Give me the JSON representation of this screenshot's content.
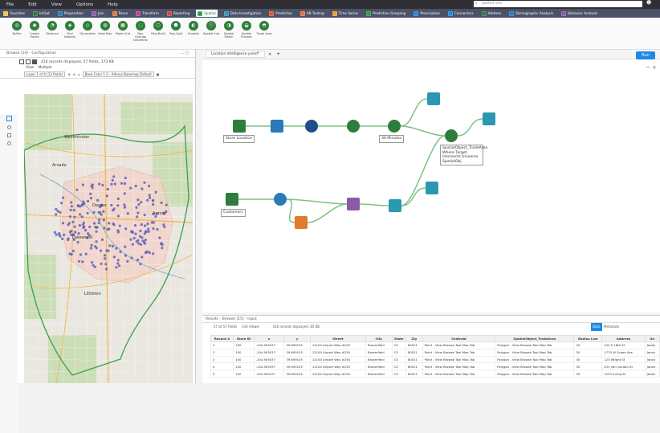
{
  "menu": {
    "items": [
      "File",
      "Edit",
      "View",
      "Options",
      "Help"
    ],
    "search_placeholder": "spatial info"
  },
  "categories": [
    {
      "label": "Favorites",
      "color": "#f4c542"
    },
    {
      "label": "In/Out",
      "color": "#2f7d3c"
    },
    {
      "label": "Preparation",
      "color": "#2a7ab9"
    },
    {
      "label": "Join",
      "color": "#8a5aa8"
    },
    {
      "label": "Parse",
      "color": "#e07a2e"
    },
    {
      "label": "Transform",
      "color": "#c2418d"
    },
    {
      "label": "Reporting",
      "color": "#d14a3c"
    },
    {
      "label": "Spatial",
      "color": "#2f9a4a"
    },
    {
      "label": "Data Investigation",
      "color": "#2a98b3"
    },
    {
      "label": "Predictive",
      "color": "#e0552e"
    },
    {
      "label": "AB Testing",
      "color": "#e87236"
    },
    {
      "label": "Time Series",
      "color": "#f59a2f"
    },
    {
      "label": "Predictive Grouping",
      "color": "#2f9a4a"
    },
    {
      "label": "Prescriptive",
      "color": "#1e88e5"
    },
    {
      "label": "Connectors",
      "color": "#1e88e5"
    },
    {
      "label": "Address",
      "color": "#2f7d3c"
    },
    {
      "label": "Demographic Analysis",
      "color": "#2a7ab9"
    },
    {
      "label": "Behavior Analysis",
      "color": "#8a5aa8"
    }
  ],
  "active_category": "Spatial",
  "tools": [
    {
      "label": "Buffer"
    },
    {
      "label": "Create Points"
    },
    {
      "label": "Distance"
    },
    {
      "label": "Find Nearest"
    },
    {
      "label": "Generalize"
    },
    {
      "label": "Heat Map"
    },
    {
      "label": "Make Grid"
    },
    {
      "label": "Non Overlap Drivetime"
    },
    {
      "label": "Poly-Build"
    },
    {
      "label": "Poly-Split"
    },
    {
      "label": "Smooth"
    },
    {
      "label": "Spatial Info"
    },
    {
      "label": "Spatial Match"
    },
    {
      "label": "Spatial Process"
    },
    {
      "label": "Trade Area"
    }
  ],
  "left_panel": {
    "title": "Browse (14) - Configuration",
    "records": "416 records displayed, 57 fields, 173 KB",
    "view_label": "View",
    "mode_label": "Multiple",
    "layer_select": "Layer 1 of 4 (13 fields)",
    "basemap_select": "Base Color 1.0 - Alteryx Basemap Default"
  },
  "map_labels": [
    "Arvada",
    "Lakewood",
    "Denver",
    "Aurora",
    "Westminster",
    "Littleton"
  ],
  "canvas": {
    "tab": "Location Intelligence.yxmd*",
    "run": "Run",
    "nodes": [
      {
        "label": "Store Location"
      },
      {
        "label": "30 Minutes"
      },
      {
        "label": "SpatialObject_TradeArea Where Target Intersects Universe SpatialObj"
      },
      {
        "label": "Customers"
      }
    ]
  },
  "results": {
    "title": "Results - Browse (15) - Input",
    "bar": "57 of 57 Fields",
    "cell_viewer": "Cell Viewer",
    "records_text": "416 records displayed, 85 KB",
    "data_btn": "Data",
    "meta_btn": "Metadata",
    "columns": [
      "Record #",
      "Store ID",
      "x",
      "y",
      "Street",
      "City",
      "State",
      "Zip",
      "Centroid",
      "SpatialObject_TradeArea",
      "Radius Low",
      "Address",
      "Un"
    ],
    "rows": [
      [
        "1",
        "100",
        "-104.905037",
        "39.609105",
        "12100 Airport Way #250",
        "Broomfield",
        "CO",
        "80021",
        "Point - View Browse Tool Map Tab",
        "Polygon - View Browse Tool Map Tab",
        "30",
        "100 S 16th St",
        "Jacob"
      ],
      [
        "2",
        "100",
        "-104.905037",
        "39.609105",
        "12100 Airport Way #250",
        "Broomfield",
        "CO",
        "80021",
        "Point - View Browse Tool Map Tab",
        "Polygon - View Browse Tool Map Tab",
        "30",
        "1770 W Grape Ave",
        "Jacob"
      ],
      [
        "3",
        "100",
        "-104.905037",
        "39.609105",
        "12100 Airport Way #250",
        "Broomfield",
        "CO",
        "80021",
        "Point - View Browse Tool Map Tab",
        "Polygon - View Browse Tool Map Tab",
        "30",
        "123 Wright St",
        "Jacob"
      ],
      [
        "4",
        "100",
        "-104.905037",
        "39.609105",
        "12100 Airport Way #250",
        "Broomfield",
        "CO",
        "80021",
        "Point - View Browse Tool Map Tab",
        "Polygon - View Browse Tool Map Tab",
        "30",
        "433 Van Gordon St",
        "Jacob"
      ],
      [
        "5",
        "100",
        "-104.905037",
        "39.609105",
        "12100 Airport Way #250",
        "Broomfield",
        "CO",
        "80021",
        "Point - View Browse Tool Map Tab",
        "Polygon - View Browse Tool Map Tab",
        "30",
        "1203 Irving St",
        "Jacob"
      ]
    ]
  }
}
